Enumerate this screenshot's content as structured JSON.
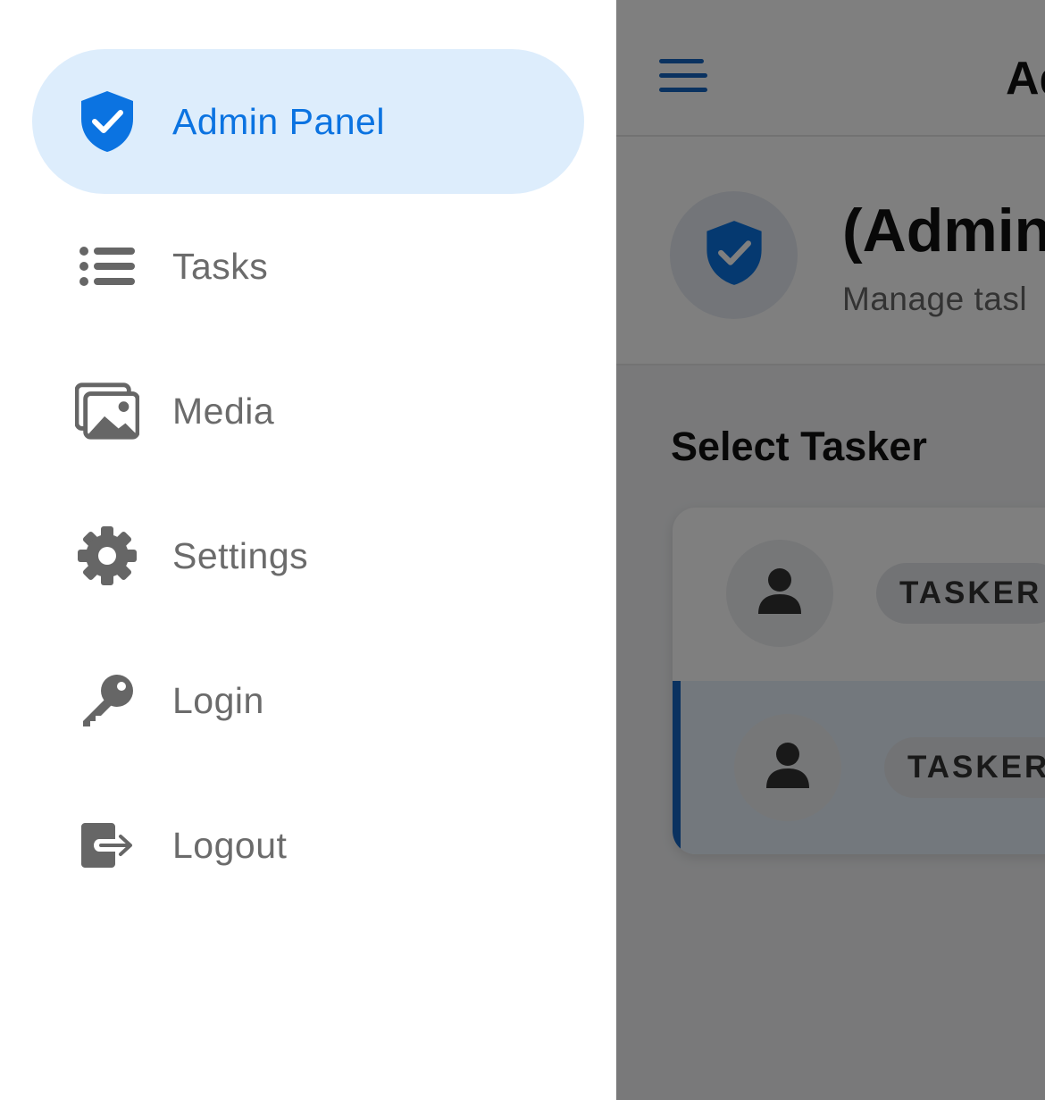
{
  "drawer": {
    "items": [
      {
        "label": "Admin Panel",
        "icon": "shield-check-icon",
        "active": true
      },
      {
        "label": "Tasks",
        "icon": "list-icon",
        "active": false
      },
      {
        "label": "Media",
        "icon": "images-icon",
        "active": false
      },
      {
        "label": "Settings",
        "icon": "gear-icon",
        "active": false
      },
      {
        "label": "Login",
        "icon": "key-icon",
        "active": false
      },
      {
        "label": "Logout",
        "icon": "logout-icon",
        "active": false
      }
    ]
  },
  "main": {
    "title": "Ad",
    "header": {
      "title": "(Admin",
      "subtitle": "Manage tasl"
    },
    "section_title": "Select Tasker",
    "taskers": [
      {
        "role": "TASKER",
        "selected": false
      },
      {
        "role": "TASKER",
        "selected": true
      }
    ]
  },
  "colors": {
    "accent": "#0b73e1",
    "active_bg": "#ddedfc",
    "icon_gray": "#666666",
    "selected_bar": "#1565c0"
  }
}
